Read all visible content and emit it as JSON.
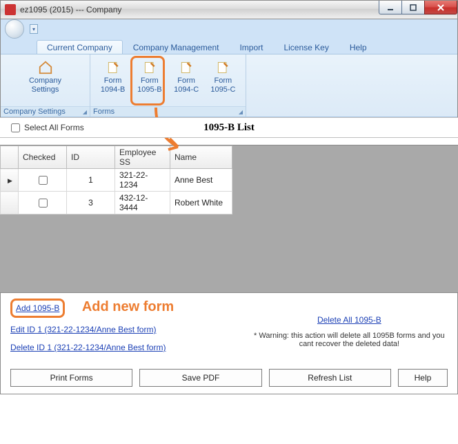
{
  "window": {
    "title": "ez1095 (2015) --- Company"
  },
  "tabs": {
    "current_company": "Current Company",
    "company_management": "Company Management",
    "import": "Import",
    "license_key": "License Key",
    "help": "Help"
  },
  "ribbon": {
    "group1_title": "Company Settings",
    "group2_title": "Forms",
    "company_settings": "Company\nSettings",
    "form_1094b": "Form\n1094-B",
    "form_1095b": "Form\n1095-B",
    "form_1094c": "Form\n1094-C",
    "form_1095c": "Form\n1095-C"
  },
  "list": {
    "select_all": "Select All Forms",
    "title": "1095-B List",
    "columns": {
      "checked": "Checked",
      "id": "ID",
      "ss": "Employee SS",
      "name": "Name"
    },
    "rows": [
      {
        "checked": false,
        "id": "1",
        "ss": "321-22-1234",
        "name": "Anne Best"
      },
      {
        "checked": false,
        "id": "3",
        "ss": "432-12-3444",
        "name": "Robert White"
      }
    ]
  },
  "links": {
    "add": "Add 1095-B",
    "edit": "Edit ID 1 (321-22-1234/Anne Best form)",
    "delete": "Delete ID 1 (321-22-1234/Anne Best form)",
    "delete_all": "Delete All 1095-B",
    "warning": "* Warning: this action will delete all 1095B forms and you cant recover the deleted data!"
  },
  "annotation": {
    "add_new_form": "Add new form"
  },
  "buttons": {
    "print": "Print Forms",
    "save_pdf": "Save PDF",
    "refresh": "Refresh List",
    "help": "Help"
  }
}
